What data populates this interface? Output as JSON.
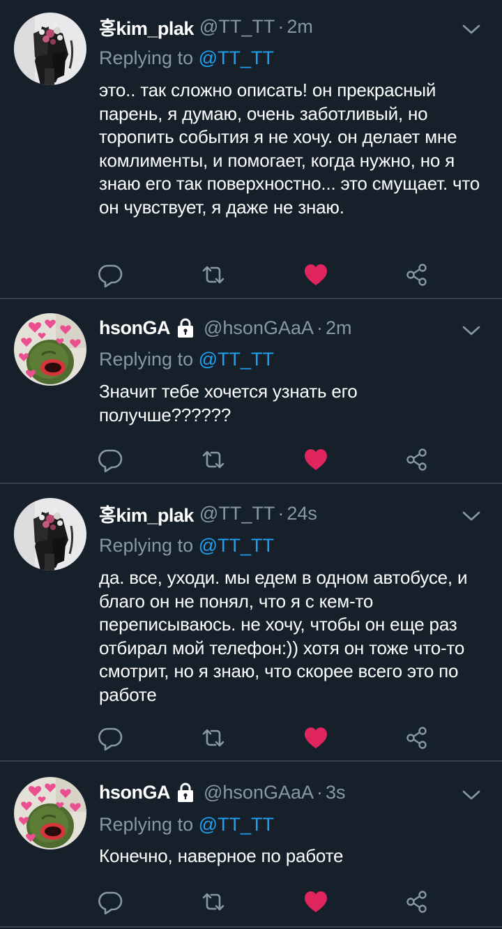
{
  "tweets": [
    {
      "display_name": "홍kim_plak",
      "handle": "@TT_TT",
      "separator": "·",
      "time": "2m",
      "replying_prefix": "Replying to ",
      "replying_to": "@TT_TT",
      "text": "это.. так сложно описать! он прекрасный парень, я думаю, очень заботливый, но торопить события я не хочу. он делает мне комлименты, и помогает, когда нужно, но я знаю его так поверхностно... это смущает. что он чувствует, я даже не знаю.",
      "avatar": "flower-bouquet-avatar",
      "liked": true
    },
    {
      "display_name": "hsonGA",
      "handle": "@hsonGAaA",
      "separator": "·",
      "time": "2m",
      "replying_prefix": "Replying to ",
      "replying_to": "@TT_TT",
      "text": "Значит тебе хочется узнать его получше??????",
      "avatar": "kermit-hearts-avatar",
      "protected": true,
      "liked": true
    },
    {
      "display_name": "홍kim_plak",
      "handle": "@TT_TT",
      "separator": "·",
      "time": "24s",
      "replying_prefix": "Replying to ",
      "replying_to": "@TT_TT",
      "text": "да. все, уходи. мы едем в одном автобусе, и благо он не понял, что я с кем-то переписываюсь. не хочу, чтобы он еще раз отбирал мой телефон:)) хотя он тоже что-то смотрит, но я знаю, что скорее всего это по работе",
      "avatar": "flower-bouquet-avatar",
      "liked": true
    },
    {
      "display_name": "hsonGA",
      "handle": "@hsonGAaA",
      "separator": "·",
      "time": "3s",
      "replying_prefix": "Replying to ",
      "replying_to": "@TT_TT",
      "text": "Конечно, наверное по работе",
      "avatar": "kermit-hearts-avatar",
      "protected": true,
      "liked": true
    }
  ],
  "icons": {
    "reply": "reply-icon",
    "retweet": "retweet-icon",
    "like": "heart-icon",
    "share": "share-icon",
    "menu": "chevron-down-icon",
    "protected": "lock-icon"
  },
  "colors": {
    "background": "#15202b",
    "divider": "#38444d",
    "secondary_text": "#8899a6",
    "link": "#1da1f2",
    "like": "#e0245e"
  }
}
